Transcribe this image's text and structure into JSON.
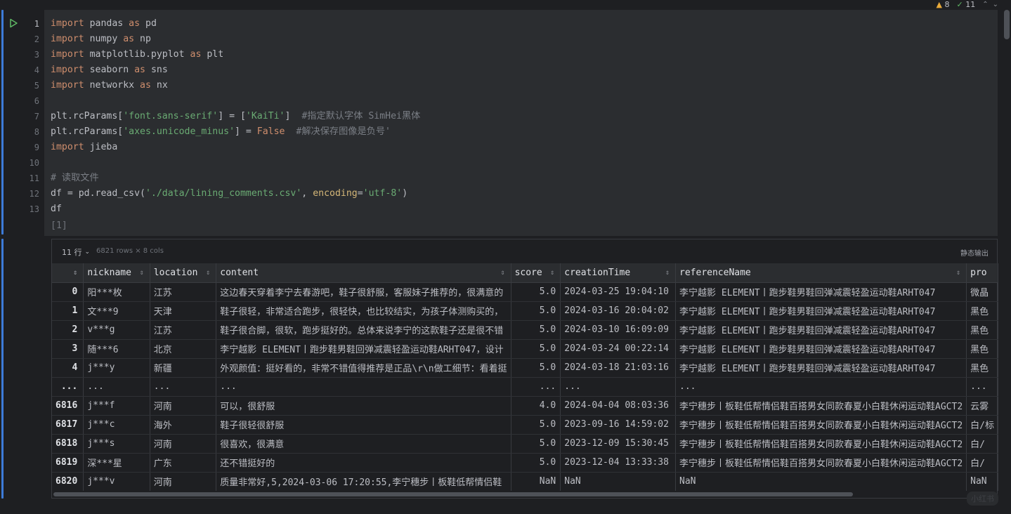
{
  "status": {
    "warnings": "8",
    "checks": "11"
  },
  "gutter": {
    "lines": [
      "1",
      "2",
      "3",
      "4",
      "5",
      "6",
      "7",
      "8",
      "9",
      "10",
      "11",
      "12",
      "13"
    ]
  },
  "code": {
    "lines": [
      [
        {
          "t": "import",
          "c": "kw"
        },
        {
          "t": " pandas "
        },
        {
          "t": "as",
          "c": "kw"
        },
        {
          "t": " pd"
        }
      ],
      [
        {
          "t": "import",
          "c": "kw"
        },
        {
          "t": " numpy "
        },
        {
          "t": "as",
          "c": "kw"
        },
        {
          "t": " np"
        }
      ],
      [
        {
          "t": "import",
          "c": "kw"
        },
        {
          "t": " matplotlib.pyplot "
        },
        {
          "t": "as",
          "c": "kw"
        },
        {
          "t": " plt"
        }
      ],
      [
        {
          "t": "import",
          "c": "kw"
        },
        {
          "t": " seaborn "
        },
        {
          "t": "as",
          "c": "kw"
        },
        {
          "t": " sns"
        }
      ],
      [
        {
          "t": "import",
          "c": "kw"
        },
        {
          "t": " networkx "
        },
        {
          "t": "as",
          "c": "kw"
        },
        {
          "t": " nx"
        }
      ],
      [],
      [
        {
          "t": "plt.rcParams["
        },
        {
          "t": "'font.sans-serif'",
          "c": "str"
        },
        {
          "t": "] = ["
        },
        {
          "t": "'KaiTi'",
          "c": "str"
        },
        {
          "t": "]  "
        },
        {
          "t": "#指定默认字体 SimHei黑体",
          "c": "cmt"
        }
      ],
      [
        {
          "t": "plt.rcParams["
        },
        {
          "t": "'axes.unicode_minus'",
          "c": "str"
        },
        {
          "t": "] = "
        },
        {
          "t": "False",
          "c": "kw"
        },
        {
          "t": "  "
        },
        {
          "t": "#解决保存图像是负号'",
          "c": "cmt"
        }
      ],
      [
        {
          "t": "import",
          "c": "kw"
        },
        {
          "t": " jieba"
        }
      ],
      [],
      [
        {
          "t": "# 读取文件",
          "c": "cmt"
        }
      ],
      [
        {
          "t": "df = pd.read_csv("
        },
        {
          "t": "'./data/lining_comments.csv'",
          "c": "str"
        },
        {
          "t": ", "
        },
        {
          "t": "encoding",
          "c": "param"
        },
        {
          "t": "="
        },
        {
          "t": "'utf-8'",
          "c": "str"
        },
        {
          "t": ")"
        }
      ],
      [
        {
          "t": "df"
        }
      ]
    ],
    "exec_count": "[1]"
  },
  "output": {
    "rows_select": "11 行",
    "shape": "6821 rows × 8 cols",
    "static_label": "静态输出"
  },
  "table": {
    "headers": [
      "",
      "nickname",
      "location",
      "content",
      "score",
      "creationTime",
      "referenceName",
      "pro"
    ],
    "rows": [
      [
        "0",
        "阳***枚",
        "江苏",
        "这边春天穿着李宁去春游吧，鞋子很舒服，客服妹子推荐的，很满意的",
        "5.0",
        "2024-03-25 19:04:10",
        "李宁越影 ELEMENT丨跑步鞋男鞋回弹减震轻盈运动鞋ARHT047",
        "微晶"
      ],
      [
        "1",
        "文***9",
        "天津",
        "鞋子很轻，非常适合跑步，很轻快，也比较结实，为孩子体测购买的，",
        "5.0",
        "2024-03-16 20:04:02",
        "李宁越影 ELEMENT丨跑步鞋男鞋回弹减震轻盈运动鞋ARHT047",
        "黑色"
      ],
      [
        "2",
        "v***g",
        "江苏",
        "鞋子很合脚，很软，跑步挺好的。总体来说李宁的这款鞋子还是很不错",
        "5.0",
        "2024-03-10 16:09:09",
        "李宁越影 ELEMENT丨跑步鞋男鞋回弹减震轻盈运动鞋ARHT047",
        "黑色"
      ],
      [
        "3",
        "随***6",
        "北京",
        "李宁越影 ELEMENT丨跑步鞋男鞋回弹减震轻盈运动鞋ARHT047，设计",
        "5.0",
        "2024-03-24 00:22:14",
        "李宁越影 ELEMENT丨跑步鞋男鞋回弹减震轻盈运动鞋ARHT047",
        "黑色"
      ],
      [
        "4",
        "j***y",
        "新疆",
        "外观颜值：挺好看的，非常不错值得推荐是正品\\r\\n做工细节：看着挺",
        "5.0",
        "2024-03-18 21:03:16",
        "李宁越影 ELEMENT丨跑步鞋男鞋回弹减震轻盈运动鞋ARHT047",
        "黑色"
      ],
      [
        "...",
        "...",
        "...",
        "...",
        "...",
        "...",
        "...",
        "..."
      ],
      [
        "6816",
        "j***f",
        "河南",
        "可以，很舒服",
        "4.0",
        "2024-04-04 08:03:36",
        "李宁穗步丨板鞋低帮情侣鞋百搭男女同款春夏小白鞋休闲运动鞋AGCT2",
        "云雾"
      ],
      [
        "6817",
        "j***c",
        "海外",
        "鞋子很轻很舒服",
        "5.0",
        "2023-09-16 14:59:02",
        "李宁穗步丨板鞋低帮情侣鞋百搭男女同款春夏小白鞋休闲运动鞋AGCT2",
        "白/标"
      ],
      [
        "6818",
        "j***s",
        "河南",
        "很喜欢，很满意",
        "5.0",
        "2023-12-09 15:30:45",
        "李宁穗步丨板鞋低帮情侣鞋百搭男女同款春夏小白鞋休闲运动鞋AGCT2",
        "白/"
      ],
      [
        "6819",
        "深***星",
        "广东",
        "还不错挺好的",
        "5.0",
        "2023-12-04 13:33:38",
        "李宁穗步丨板鞋低帮情侣鞋百搭男女同款春夏小白鞋休闲运动鞋AGCT2",
        "白/"
      ],
      [
        "6820",
        "j***v",
        "河南",
        "质量非常好,5,2024-03-06 17:20:55,李宁穗步丨板鞋低帮情侣鞋",
        "NaN",
        "NaN",
        "NaN",
        "NaN"
      ]
    ]
  },
  "watermark": "小红书"
}
